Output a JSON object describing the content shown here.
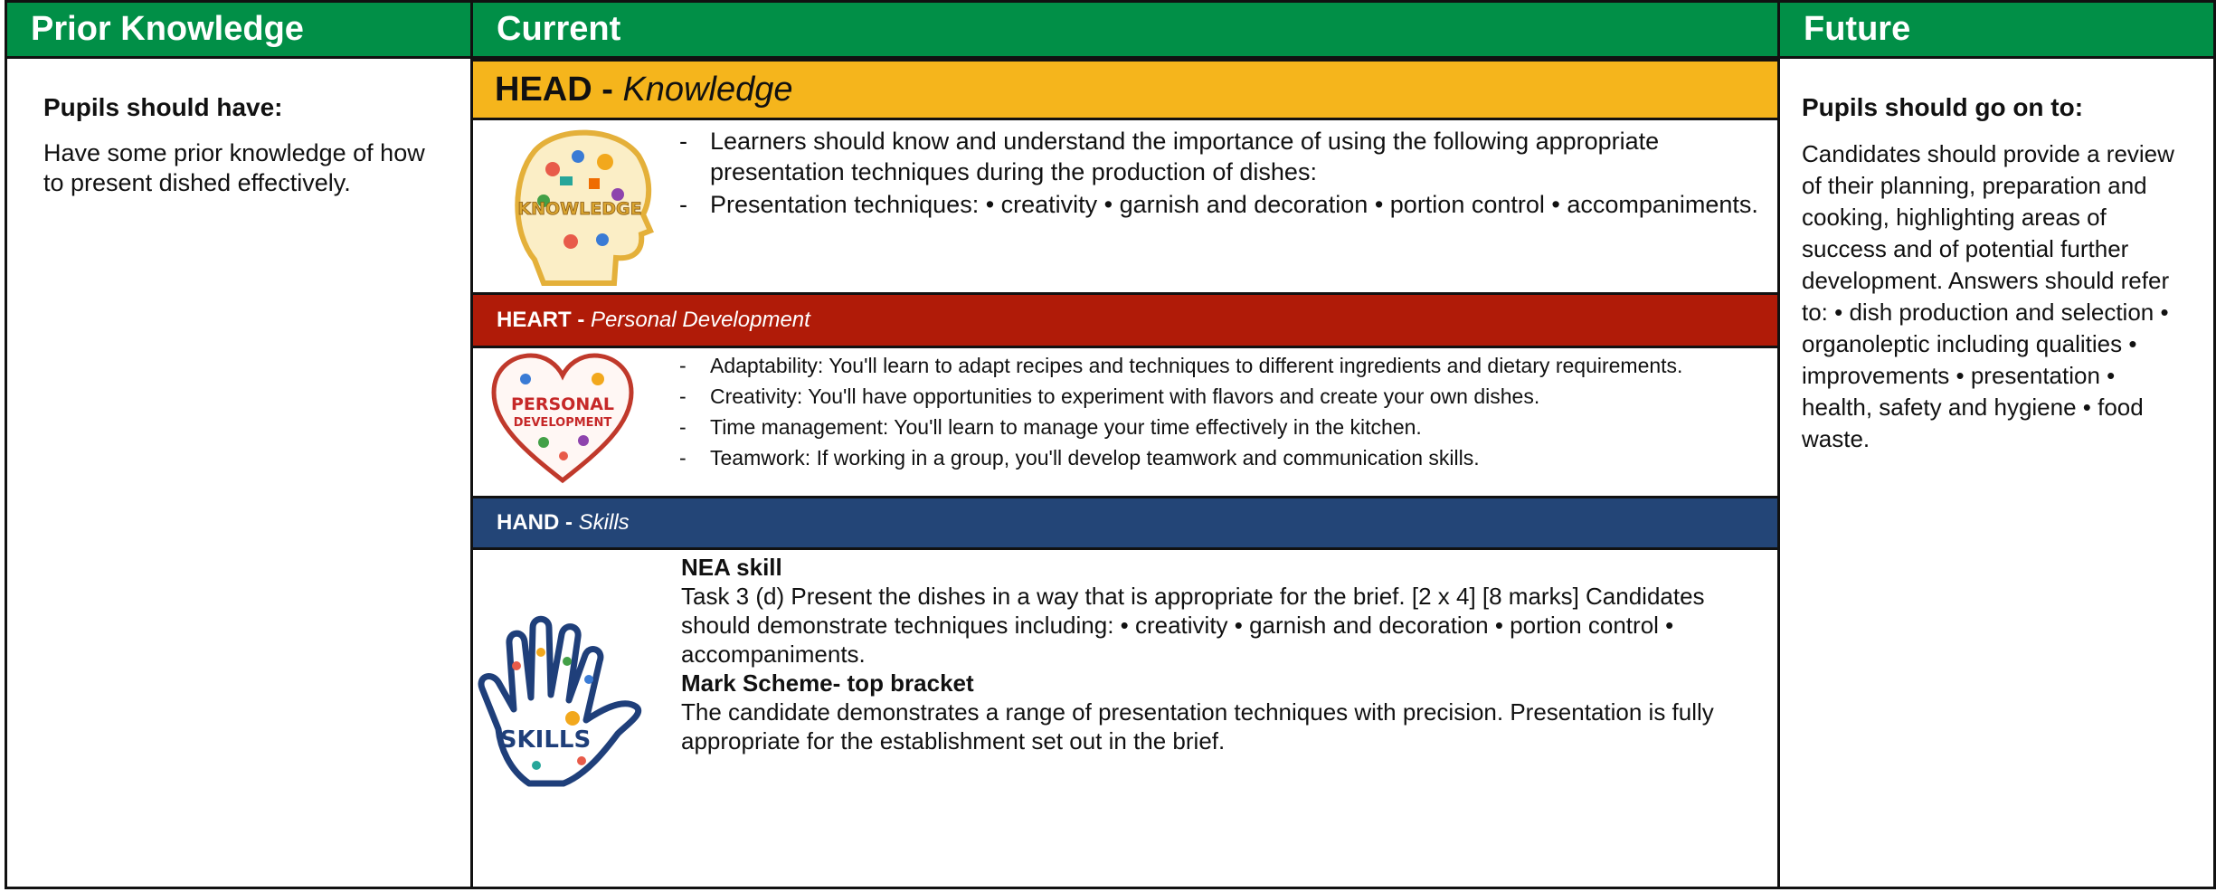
{
  "prior": {
    "header": "Prior Knowledge",
    "subheading": "Pupils should have:",
    "text": "Have some prior  knowledge of how to present dished effectively."
  },
  "current": {
    "header": "Current",
    "head": {
      "title_bold": "HEAD -",
      "title_italic": "Knowledge",
      "image_label": "KNOWLEDGE",
      "items": [
        "Learners should know and understand the importance of using the following appropriate presentation techniques during the production of dishes:",
        "Presentation techniques: • creativity • garnish and decoration • portion control • accompaniments."
      ]
    },
    "heart": {
      "title_bold": "HEART -",
      "title_italic": "Personal Development",
      "image_label_1": "PERSONAL",
      "image_label_2": "DEVELOPMENT",
      "items": [
        "Adaptability: You'll learn to adapt recipes and techniques to different ingredients and dietary requirements.",
        "Creativity: You'll have opportunities to experiment with flavors and create your own dishes.",
        "Time management: You'll learn to manage your time effectively in the kitchen.",
        "Teamwork: If working in a group, you'll develop teamwork and communication skills."
      ]
    },
    "hand": {
      "title_bold": "HAND -",
      "title_italic": "Skills",
      "image_label": "SKILLS",
      "nea_heading": "NEA skill",
      "nea_text": "Task 3 (d) Present the dishes in a way that is appropriate for the brief. [2 x 4] [8 marks] Candidates should demonstrate techniques including: • creativity • garnish and decoration • portion control • accompaniments.",
      "mark_heading": "Mark Scheme- top bracket",
      "mark_text": "The candidate demonstrates a range of presentation techniques with precision. Presentation is fully appropriate for the establishment set out in the brief."
    }
  },
  "future": {
    "header": "Future",
    "subheading": "Pupils should go on to:",
    "text": "Candidates should provide a review of their planning, preparation and cooking, highlighting areas of success and of potential further development. Answers should refer to: • dish production and selection • organoleptic including qualities • improvements • presentation • health, safety and hygiene • food waste."
  },
  "colors": {
    "header_green": "#018f47",
    "head_yellow": "#f5b51c",
    "heart_red": "#b01b08",
    "hand_blue": "#234577"
  }
}
